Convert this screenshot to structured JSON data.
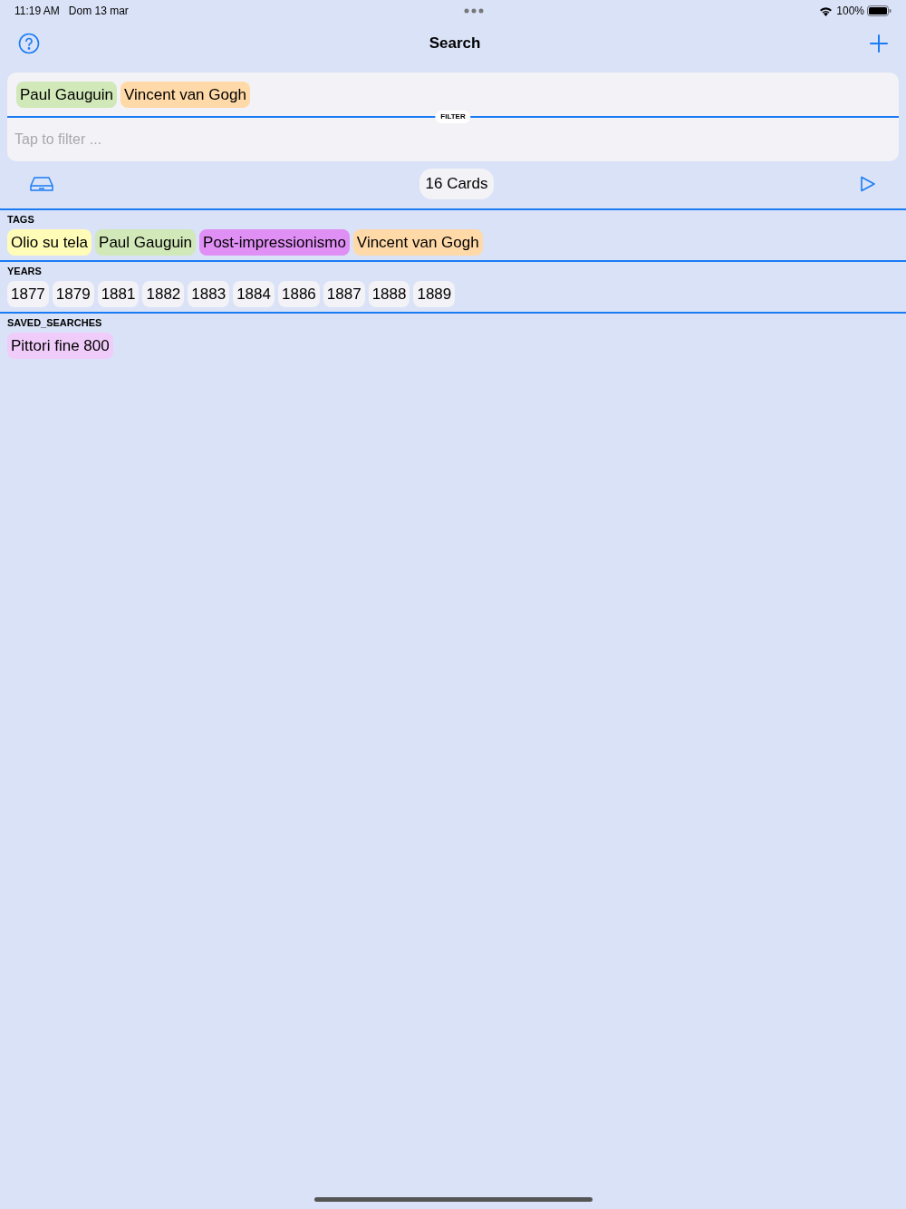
{
  "status_bar": {
    "time": "11:19 AM",
    "date": "Dom 13 mar",
    "battery": "100%"
  },
  "nav": {
    "title": "Search"
  },
  "search": {
    "selected_tags": [
      {
        "label": "Paul Gauguin",
        "color": "#d1e8b8"
      },
      {
        "label": "Vincent van Gogh",
        "color": "#ffd9a8"
      }
    ],
    "divider_label": "FILTER",
    "placeholder": "Tap to filter ..."
  },
  "toolbar": {
    "count": "16 Cards"
  },
  "sections": [
    {
      "title": "TAGS",
      "chips": [
        {
          "label": "Olio su tela",
          "color": "#fffcb8"
        },
        {
          "label": "Paul Gauguin",
          "color": "#d1e8b8"
        },
        {
          "label": "Post-impressionismo",
          "color": "#e08ff5"
        },
        {
          "label": "Vincent van Gogh",
          "color": "#ffd9a8"
        }
      ]
    },
    {
      "title": "YEARS",
      "chips": [
        {
          "label": "1877"
        },
        {
          "label": "1879"
        },
        {
          "label": "1881"
        },
        {
          "label": "1882"
        },
        {
          "label": "1883"
        },
        {
          "label": "1884"
        },
        {
          "label": "1886"
        },
        {
          "label": "1887"
        },
        {
          "label": "1888"
        },
        {
          "label": "1889"
        }
      ]
    },
    {
      "title": "SAVED_SEARCHES",
      "chips": [
        {
          "label": "Pittori fine 800",
          "color": "#f0ccfa"
        }
      ]
    }
  ]
}
